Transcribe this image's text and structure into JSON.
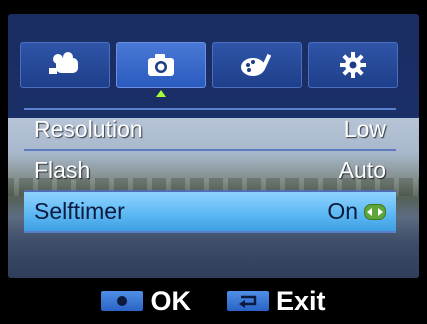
{
  "tabs": [
    {
      "icon": "movie-camera-icon",
      "active": false
    },
    {
      "icon": "camera-icon",
      "active": true
    },
    {
      "icon": "palette-icon",
      "active": false
    },
    {
      "icon": "gear-icon",
      "active": false
    }
  ],
  "menu": {
    "items": [
      {
        "label": "Resolution",
        "value": "Low"
      },
      {
        "label": "Flash",
        "value": "Auto"
      },
      {
        "label": "Selftimer",
        "value": "On"
      }
    ]
  },
  "footer": {
    "ok_label": "OK",
    "exit_label": "Exit"
  },
  "colors": {
    "accent": "#2b5bbf",
    "selected_row": "#5ab7f2",
    "caret": "#a6ff3a"
  }
}
